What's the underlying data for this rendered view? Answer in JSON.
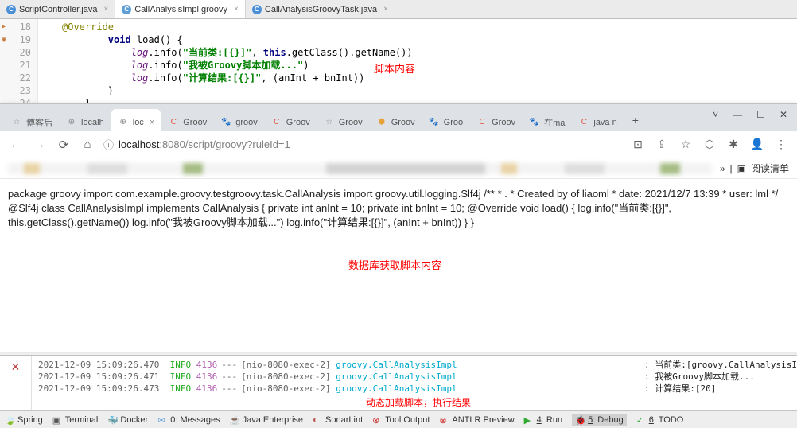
{
  "ide_tabs": [
    {
      "icon": "C",
      "label": "ScriptController.java",
      "active": false
    },
    {
      "icon": "C",
      "label": "CallAnalysisImpl.groovy",
      "active": true
    },
    {
      "icon": "C",
      "label": "CallAnalysisGroovyTask.java",
      "active": false
    }
  ],
  "code": {
    "lines": [
      "18",
      "19",
      "20",
      "21",
      "22",
      "23",
      "24"
    ],
    "l18": "        @Override",
    "l19_kw": "void",
    "l19_rest": " load() {",
    "l20_field": "log",
    "l20_a": ".info(",
    "l20_str": "\"当前类:[{}]\"",
    "l20_b": ", ",
    "l20_kw": "this",
    "l20_c": ".getClass().getName())",
    "l21_field": "log",
    "l21_a": ".info(",
    "l21_str": "\"我被Groovy脚本加载...\"",
    "l21_b": ")",
    "l22_field": "log",
    "l22_a": ".info(",
    "l22_str": "\"计算结果:[{}]\"",
    "l22_b": ", (anInt + bnInt))",
    "l23": "        }",
    "annotation": "脚本内容"
  },
  "browser": {
    "tabs": [
      {
        "fav": "☆",
        "label": "博客后",
        "color": "#888"
      },
      {
        "fav": "⊕",
        "label": "localh",
        "color": "#888"
      },
      {
        "fav": "⊕",
        "label": "loc",
        "color": "#888",
        "active": true
      },
      {
        "fav": "C",
        "label": "Groov",
        "color": "#e25241"
      },
      {
        "fav": "🐾",
        "label": "groov",
        "color": "#4a6"
      },
      {
        "fav": "C",
        "label": "Groov",
        "color": "#e25241"
      },
      {
        "fav": "☆",
        "label": "Groov",
        "color": "#888"
      },
      {
        "fav": "⬢",
        "label": "Groov",
        "color": "#e8a23c"
      },
      {
        "fav": "🐾",
        "label": "Groo",
        "color": "#4a6"
      },
      {
        "fav": "C",
        "label": "Groov",
        "color": "#e25241"
      },
      {
        "fav": "🐾",
        "label": "在ma",
        "color": "#4a6"
      },
      {
        "fav": "C",
        "label": "java n",
        "color": "#e25241"
      }
    ],
    "url_host": "localhost",
    "url_port": ":8080",
    "url_path": "/script/groovy?ruleId=1",
    "reading_list": "阅读清单",
    "win": {
      "min": "—",
      "max": "☐",
      "close": "✕",
      "down": "˅"
    }
  },
  "page": {
    "content": "package groovy import com.example.groovy.testgroovy.task.CallAnalysis import groovy.util.logging.Slf4j /** * . * Created by of liaoml * date: 2021/12/7 13:39 * user: lml */ @Slf4j class CallAnalysisImpl implements CallAnalysis { private int anInt = 10; private int bnInt = 10; @Override void load() { log.info(\"当前类:[{}]\", this.getClass().getName()) log.info(\"我被Groovy脚本加载...\") log.info(\"计算结果:[{}]\", (anInt + bnInt)) } }",
    "annotation": "数据库获取脚本内容"
  },
  "console": {
    "rows": [
      {
        "ts": "2021-12-09 15:09:26.470",
        "lvl": "INFO",
        "pid": "4136",
        "thr": "[nio-8080-exec-2]",
        "cls": "groovy.CallAnalysisImpl",
        "msg": ": 当前类:[groovy.CallAnalysisImpl]"
      },
      {
        "ts": "2021-12-09 15:09:26.471",
        "lvl": "INFO",
        "pid": "4136",
        "thr": "[nio-8080-exec-2]",
        "cls": "groovy.CallAnalysisImpl",
        "msg": ": 我被Groovy脚本加载..."
      },
      {
        "ts": "2021-12-09 15:09:26.473",
        "lvl": "INFO",
        "pid": "4136",
        "thr": "[nio-8080-exec-2]",
        "cls": "groovy.CallAnalysisImpl",
        "msg": ": 计算结果:[20]"
      }
    ],
    "annotation": "动态加载脚本，执行结果"
  },
  "bottom": [
    {
      "ic": "🍃",
      "label": "Spring",
      "color": "#5a5"
    },
    {
      "ic": "▣",
      "label": "Terminal",
      "color": "#555"
    },
    {
      "ic": "🐳",
      "label": "Docker",
      "color": "#3c8"
    },
    {
      "ic": "✉",
      "label": "0: Messages",
      "color": "#59d"
    },
    {
      "ic": "☕",
      "label": "Java Enterprise",
      "color": "#b55"
    },
    {
      "ic": "◐",
      "label": "SonarLint",
      "color": "#b55"
    },
    {
      "ic": "⊗",
      "label": "Tool Output",
      "color": "#c33"
    },
    {
      "ic": "⊗",
      "label": "ANTLR Preview",
      "color": "#c33"
    },
    {
      "ic": "▶",
      "label": "4: Run",
      "color": "#3a3",
      "u": "4"
    },
    {
      "ic": "🐞",
      "label": "5: Debug",
      "color": "#888",
      "u": "5",
      "sel": true
    },
    {
      "ic": "✓",
      "label": "6: TODO",
      "color": "#3a3",
      "u": "6"
    }
  ]
}
